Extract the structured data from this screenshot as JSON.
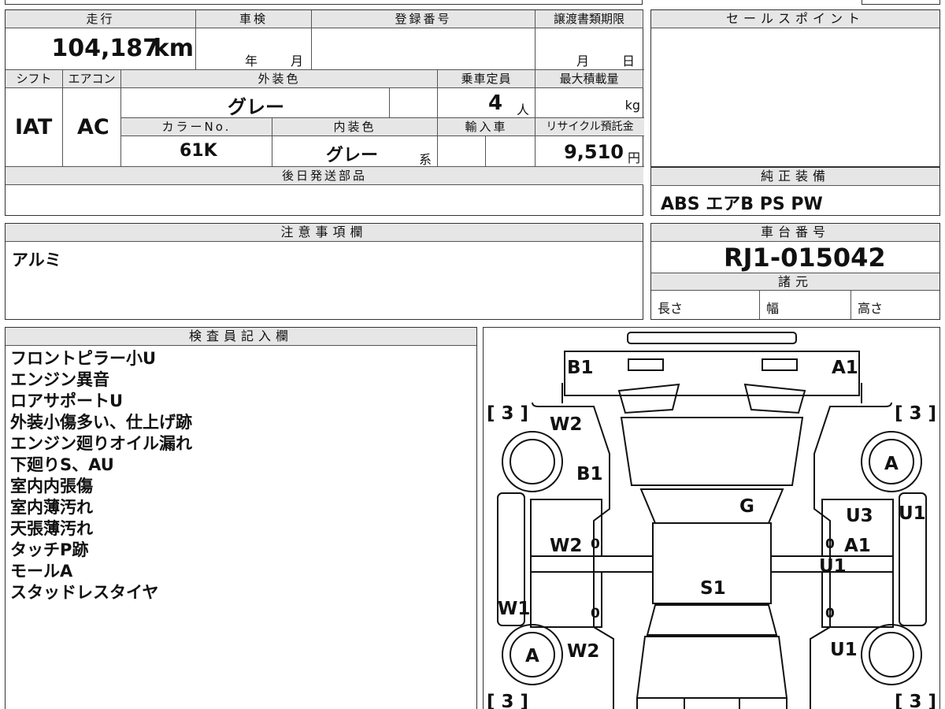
{
  "mileage": {
    "label": "走行",
    "value": "104,187",
    "unit": "km"
  },
  "inspection": {
    "label": "車検",
    "year": "年",
    "month": "月"
  },
  "registration": {
    "label": "登録番号"
  },
  "transfer": {
    "label": "譲渡書類期限",
    "month": "月",
    "day": "日"
  },
  "sales_point": {
    "label": "セールスポイント"
  },
  "shift": {
    "label": "シフト",
    "value": "IAT"
  },
  "aircon": {
    "label": "エアコン",
    "value": "AC"
  },
  "exterior_color": {
    "label": "外装色",
    "value": "グレー"
  },
  "capacity": {
    "label": "乗車定員",
    "value": "4",
    "unit": "人"
  },
  "max_load": {
    "label": "最大積載量",
    "unit": "kg"
  },
  "color_no": {
    "label": "カラーNo.",
    "value": "61K"
  },
  "interior_color": {
    "label": "内装色",
    "value": "グレー",
    "suffix": "系"
  },
  "import_car": {
    "label": "輸入車"
  },
  "recycle": {
    "label": "リサイクル預託金",
    "value": "9,510",
    "unit": "円"
  },
  "later_parts": {
    "label": "後日発送部品"
  },
  "equipment": {
    "label": "純正装備",
    "value": "ABS エアB PS PW"
  },
  "notes": {
    "label": "注意事項欄",
    "value": "アルミ"
  },
  "chassis": {
    "label": "車台番号",
    "value": "RJ1-015042"
  },
  "specs": {
    "label": "諸元",
    "length": "長さ",
    "width": "幅",
    "height": "高さ"
  },
  "inspector": {
    "label": "検査員記入欄",
    "lines": [
      "フロントピラー小U",
      "エンジン異音",
      "ロアサポートU",
      "外装小傷多い、仕上げ跡",
      "エンジン廻りオイル漏れ",
      "下廻りS、AU",
      "室内内張傷",
      "室内薄汚れ",
      "天張薄汚れ",
      "タッチP跡",
      "モールA",
      "スタッドレスタイヤ"
    ]
  },
  "diagram": {
    "marks": {
      "front_left": "B1",
      "front_right": "A1",
      "tire_count_tl": "[ 3 ]",
      "tire_count_tr": "[ 3 ]",
      "tire_count_bl": "[ 3 ]",
      "tire_count_br": "[ 3 ]",
      "fender_left": "W2",
      "wheel_right": "A",
      "hood_left": "B1",
      "windshield": "G",
      "door_right_front_top": "U3",
      "pillar_right": "U1",
      "door_left_front": "W2",
      "door_right_front": "A1",
      "door_right_mid": "U1",
      "roof": "S1",
      "rocker_left": "W1",
      "wheel_left_rear": "A",
      "quarter_left": "W2",
      "quarter_right": "U1",
      "zero_1": "0",
      "zero_2": "0",
      "zero_3": "0",
      "zero_4": "0"
    }
  }
}
